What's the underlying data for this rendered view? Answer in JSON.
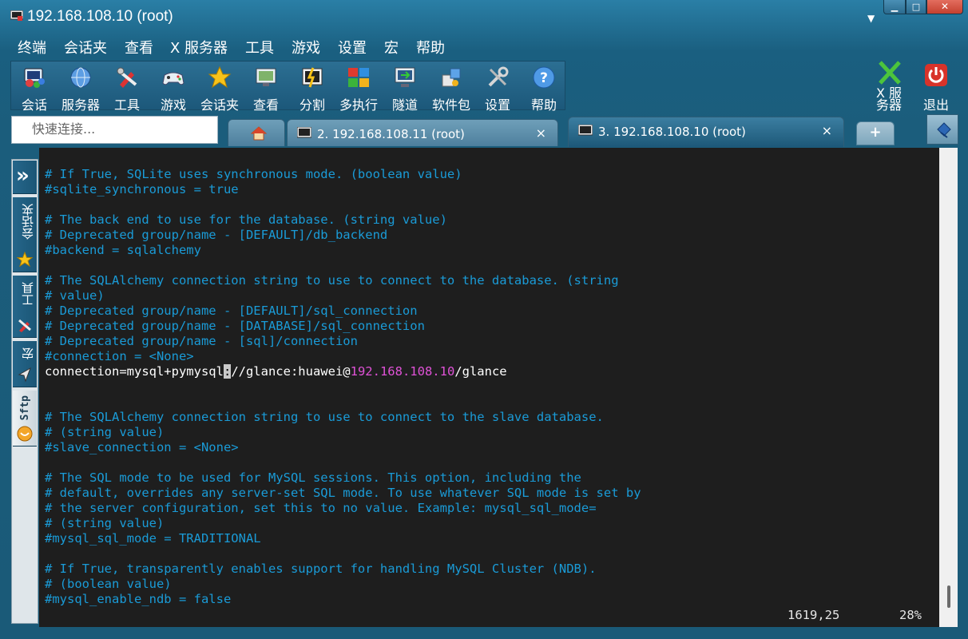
{
  "window": {
    "title": "192.168.108.10 (root)"
  },
  "menu": [
    "终端",
    "会话夹",
    "查看",
    "X 服务器",
    "工具",
    "游戏",
    "设置",
    "宏",
    "帮助"
  ],
  "toolbar": [
    {
      "label": "会话",
      "icon": "session-icon"
    },
    {
      "label": "服务器",
      "icon": "servers-icon"
    },
    {
      "label": "工具",
      "icon": "tools-icon"
    },
    {
      "label": "游戏",
      "icon": "gamepad-icon"
    },
    {
      "label": "会话夹",
      "icon": "star-icon"
    },
    {
      "label": "查看",
      "icon": "view-icon"
    },
    {
      "label": "分割",
      "icon": "split-icon"
    },
    {
      "label": "多执行",
      "icon": "multiexec-icon"
    },
    {
      "label": "隧道",
      "icon": "tunnel-icon"
    },
    {
      "label": "软件包",
      "icon": "packages-icon"
    },
    {
      "label": "设置",
      "icon": "settings-icon"
    },
    {
      "label": "帮助",
      "icon": "help-icon"
    }
  ],
  "xserver_label": "X 服务器",
  "exit_label": "退出",
  "quick_connect_placeholder": "快速连接...",
  "tabs": [
    {
      "label": "2. 192.168.108.11 (root)",
      "close": "×"
    },
    {
      "label": "3. 192.168.108.10 (root)",
      "close": "×"
    }
  ],
  "tab_add": "+",
  "sidebar": {
    "expand": "»",
    "items": [
      "会话夹",
      "工具",
      "宏",
      "Sftp"
    ]
  },
  "terminal": {
    "lines": [
      "# If True, SQLite uses synchronous mode. (boolean value)",
      "#sqlite_synchronous = true",
      "",
      "# The back end to use for the database. (string value)",
      "# Deprecated group/name - [DEFAULT]/db_backend",
      "#backend = sqlalchemy",
      "",
      "# The SQLAlchemy connection string to use to connect to the database. (string",
      "# value)",
      "# Deprecated group/name - [DEFAULT]/sql_connection",
      "# Deprecated group/name - [DATABASE]/sql_connection",
      "# Deprecated group/name - [sql]/connection",
      "#connection = <None>",
      "",
      "",
      "# The SQLAlchemy connection string to use to connect to the slave database.",
      "# (string value)",
      "#slave_connection = <None>",
      "",
      "# The SQL mode to be used for MySQL sessions. This option, including the",
      "# default, overrides any server-set SQL mode. To use whatever SQL mode is set by",
      "# the server configuration, set this to no value. Example: mysql_sql_mode=",
      "# (string value)",
      "#mysql_sql_mode = TRADITIONAL",
      "",
      "# If True, transparently enables support for handling MySQL Cluster (NDB).",
      "# (boolean value)",
      "#mysql_enable_ndb = false"
    ],
    "conn_before": "connection=mysql+pymysql",
    "conn_cursor": ":",
    "conn_mid": "//glance:huawei@",
    "conn_ip": "192.168.108.10",
    "conn_after": "/glance",
    "status_position": "1619,25",
    "status_percent": "28%"
  }
}
